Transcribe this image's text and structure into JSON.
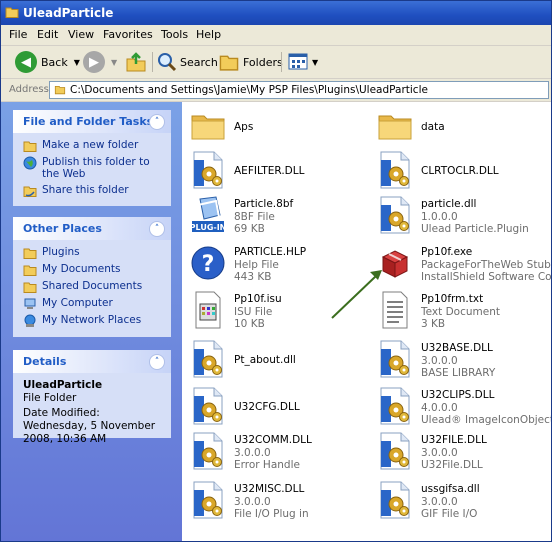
{
  "window": {
    "title": "UleadParticle"
  },
  "menu": [
    "File",
    "Edit",
    "View",
    "Favorites",
    "Tools",
    "Help"
  ],
  "toolbar": {
    "back_label": "Back",
    "search_label": "Search",
    "folders_label": "Folders"
  },
  "address": {
    "label": "Address",
    "path": "C:\\Documents and Settings\\Jamie\\My PSP Files\\Plugins\\UleadParticle"
  },
  "tasks": {
    "title": "File and Folder Tasks",
    "items": [
      {
        "label": "Make a new folder"
      },
      {
        "label": "Publish this folder to the Web"
      },
      {
        "label": "Share this folder"
      }
    ]
  },
  "places": {
    "title": "Other Places",
    "items": [
      {
        "label": "Plugins"
      },
      {
        "label": "My Documents"
      },
      {
        "label": "Shared Documents"
      },
      {
        "label": "My Computer"
      },
      {
        "label": "My Network Places"
      }
    ]
  },
  "details": {
    "title": "Details",
    "name": "UleadParticle",
    "type": "File Folder",
    "modified": "Date Modified: Wednesday, 5 November 2008, 10:36 AM"
  },
  "files": [
    {
      "name": "Aps",
      "icon": "folder"
    },
    {
      "name": "data",
      "icon": "folder"
    },
    {
      "name": "AEFILTER.DLL",
      "icon": "dll"
    },
    {
      "name": "CLRTOCLR.DLL",
      "icon": "dll"
    },
    {
      "name": "Particle.8bf",
      "line2": "8BF File",
      "line3": "69 KB",
      "icon": "plugin"
    },
    {
      "name": "particle.dll",
      "line2": "1.0.0.0",
      "line3": "Ulead Particle.Plugin",
      "icon": "dll"
    },
    {
      "name": "PARTICLE.HLP",
      "line2": "Help File",
      "line3": "443 KB",
      "icon": "help"
    },
    {
      "name": "Pp10f.exe",
      "line2": "PackageForTheWeb Stub",
      "line3": "InstallShield Software Corpora...",
      "icon": "exe"
    },
    {
      "name": "Pp10f.isu",
      "line2": "ISU File",
      "line3": "10 KB",
      "icon": "isu"
    },
    {
      "name": "Pp10frm.txt",
      "line2": "Text Document",
      "line3": "3 KB",
      "icon": "txt"
    },
    {
      "name": "Pt_about.dll",
      "icon": "dll"
    },
    {
      "name": "U32BASE.DLL",
      "line2": "3.0.0.0",
      "line3": "BASE LIBRARY",
      "icon": "dll"
    },
    {
      "name": "U32CFG.DLL",
      "icon": "dll"
    },
    {
      "name": "U32CLIPS.DLL",
      "line2": "4.0.0.0",
      "line3": "Ulead® ImageIconObject® U...",
      "icon": "dll"
    },
    {
      "name": "U32COMM.DLL",
      "line2": "3.0.0.0",
      "line3": "Error Handle",
      "icon": "dll"
    },
    {
      "name": "U32FILE.DLL",
      "line2": "3.0.0.0",
      "line3": "U32File.DLL",
      "icon": "dll"
    },
    {
      "name": "U32MISC.DLL",
      "line2": "3.0.0.0",
      "line3": "File I/O Plug in",
      "icon": "dll"
    },
    {
      "name": "ussgifsa.dll",
      "line2": "3.0.0.0",
      "line3": "GIF File I/O",
      "icon": "dll"
    }
  ],
  "colors": {
    "title_bar": "#1f4fc0",
    "task_pane": "#6375d6",
    "link": "#0c2f8e",
    "annotation_arrow": "#3b6e1e"
  }
}
